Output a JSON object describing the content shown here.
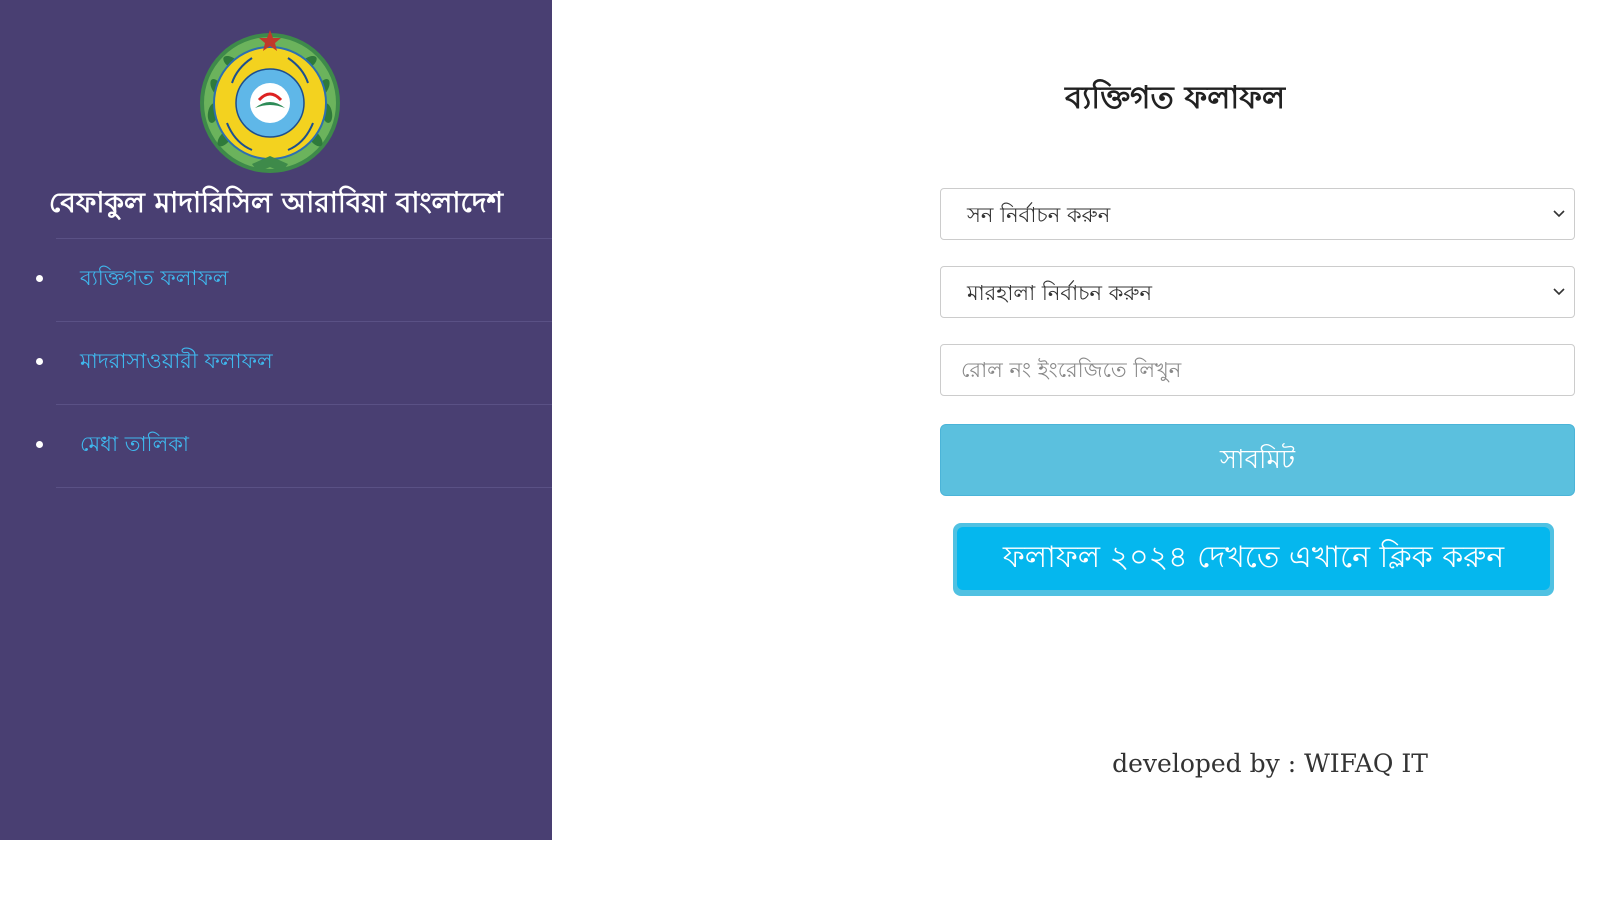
{
  "sidebar": {
    "logo_icon": "wifaq-emblem-logo",
    "org_name": "বেফাকুল মাদারিসিল আরাবিয়া বাংলাদেশ",
    "nav_items": [
      {
        "label": "ব্যক্তিগত ফলাফল"
      },
      {
        "label": "মাদরাসাওয়ারী ফলাফল"
      },
      {
        "label": "মেধা তালিকা"
      }
    ]
  },
  "main": {
    "title": "ব্যক্তিগত ফলাফল",
    "year_select": {
      "selected": "সন নির্বাচন করুন"
    },
    "level_select": {
      "selected": "মারহালা নির্বাচন করুন"
    },
    "roll_input": {
      "placeholder": "রোল নং ইংরেজিতে লিখুন",
      "value": ""
    },
    "submit_label": "সাবমিট",
    "result_banner_label": "ফলাফল ২০২৪ দেখতে এখানে ক্লিক করুন",
    "footer_credit": "developed by : WIFAQ IT"
  },
  "colors": {
    "sidebar_bg": "#493f72",
    "nav_link": "#3fb8ee",
    "submit_bg": "#5bc0de",
    "banner_bg": "#05b7ee"
  }
}
